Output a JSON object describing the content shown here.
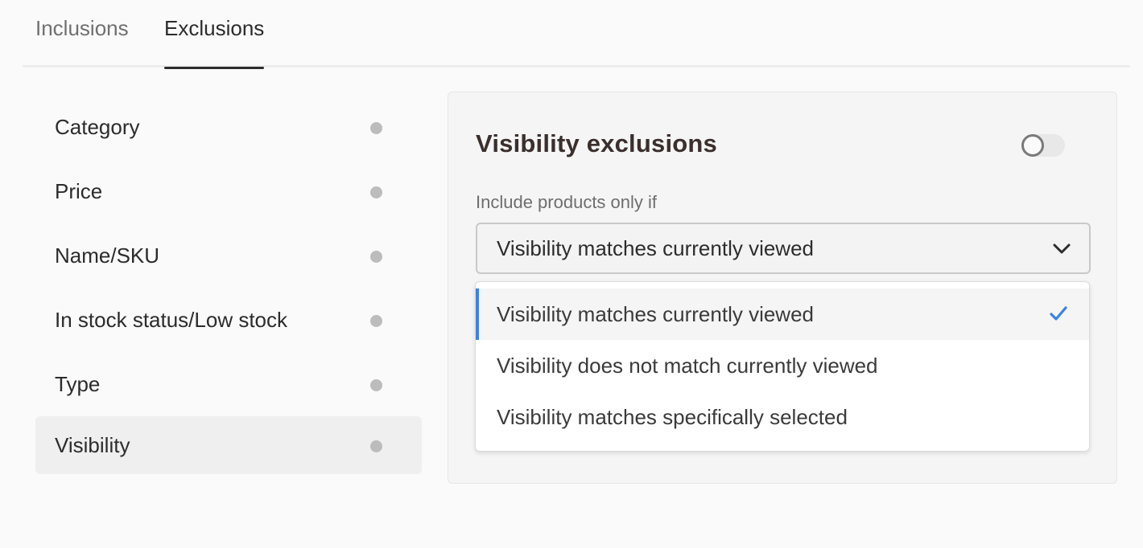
{
  "tabs": [
    {
      "label": "Inclusions",
      "active": false
    },
    {
      "label": "Exclusions",
      "active": true
    }
  ],
  "sidebar": {
    "items": [
      {
        "label": "Category"
      },
      {
        "label": "Price"
      },
      {
        "label": "Name/SKU"
      },
      {
        "label": "In stock status/Low stock"
      },
      {
        "label": "Type"
      },
      {
        "label": "Visibility",
        "active": true
      }
    ]
  },
  "panel": {
    "title": "Visibility exclusions",
    "toggle_on": false,
    "field_label": "Include products only if",
    "select_value": "Visibility matches currently viewed"
  },
  "menu": {
    "options": [
      {
        "label": "Visibility matches currently viewed",
        "selected": true
      },
      {
        "label": "Visibility does not match currently viewed",
        "selected": false
      },
      {
        "label": "Visibility matches specifically selected",
        "selected": false
      }
    ]
  },
  "colors": {
    "accent": "#3b82e6",
    "dot": "#bcbcbc",
    "title": "#3a2f2c"
  },
  "icons": {
    "select": "chevron-down-icon",
    "selected_option": "checkmark-icon"
  }
}
